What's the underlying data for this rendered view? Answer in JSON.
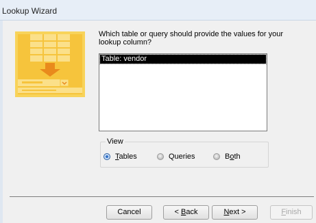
{
  "window": {
    "title": "Lookup Wizard"
  },
  "question": "Which table or query should provide the values for your lookup column?",
  "list": {
    "items": [
      "Table: vendor"
    ],
    "selected_index": 0
  },
  "view": {
    "title": "View",
    "options": [
      {
        "label": "Tables",
        "mnemonic": "T",
        "rest": "ables",
        "checked": true
      },
      {
        "label": "Queries",
        "checked": false
      },
      {
        "label": "Both",
        "before": "B",
        "mnemonic": "o",
        "rest": "th",
        "checked": false
      }
    ]
  },
  "buttons": {
    "cancel": "Cancel",
    "back": {
      "label": "< Back",
      "prefix": "< ",
      "mnemonic": "B",
      "rest": "ack"
    },
    "next": {
      "label": "Next >",
      "mnemonic": "N",
      "rest": "ext >"
    },
    "finish": {
      "label": "Finish",
      "mnemonic": "F",
      "rest": "inish",
      "enabled": false
    }
  },
  "colors": {
    "selection": "#000000",
    "illustration": "#f6c43c"
  }
}
